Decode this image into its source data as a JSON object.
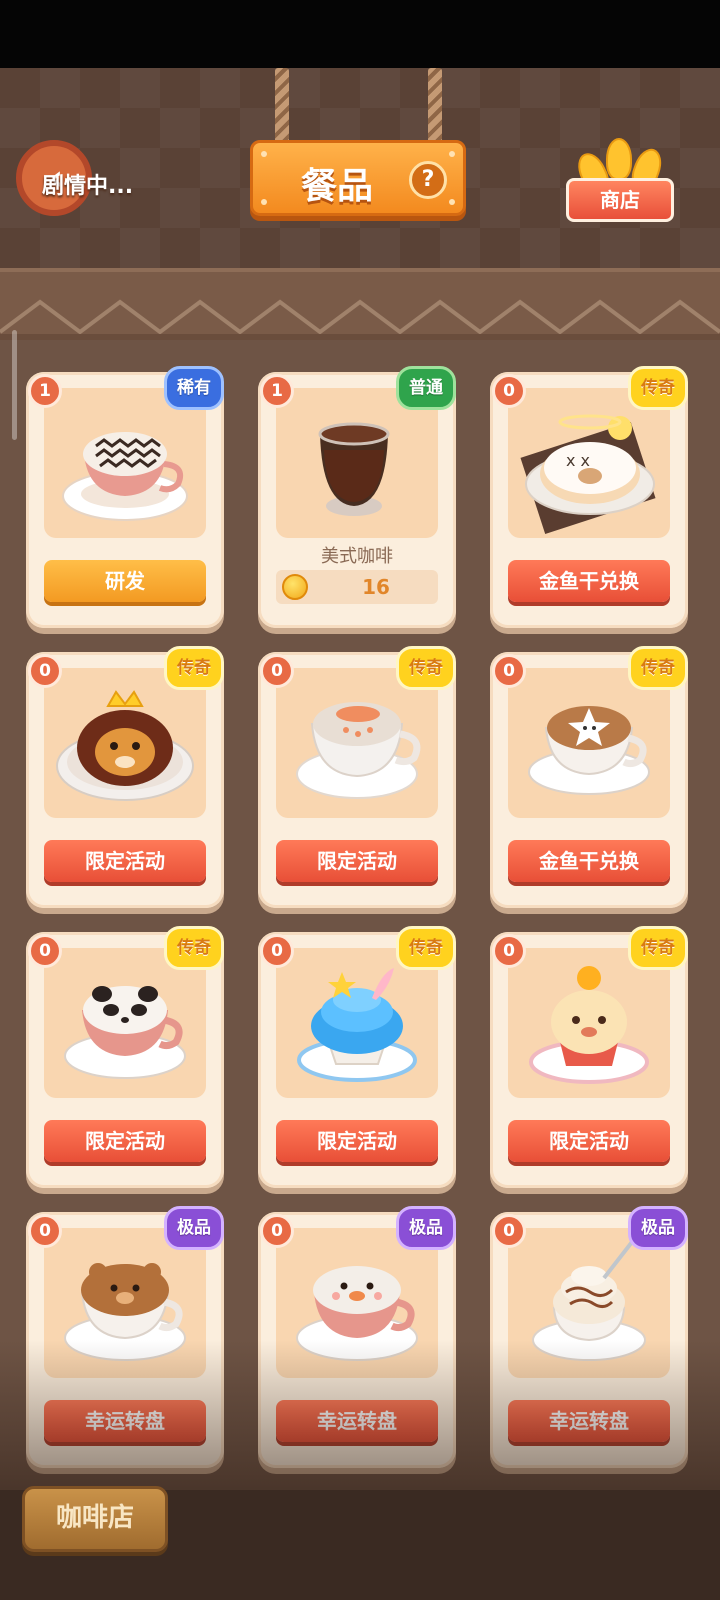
{
  "header": {
    "back_label": "剧情中...",
    "title": "餐品",
    "help_symbol": "?",
    "shop_label": "商店"
  },
  "items": [
    {
      "count": "1",
      "rarity": "稀有",
      "rarity_type": "rare",
      "button": "研发",
      "button_style": "orange",
      "food": "latte-wave"
    },
    {
      "count": "1",
      "rarity": "普通",
      "rarity_type": "common",
      "name": "美式咖啡",
      "price": "16",
      "food": "americano"
    },
    {
      "count": "0",
      "rarity": "传奇",
      "rarity_type": "legend",
      "button": "金鱼干兑换",
      "button_style": "red",
      "food": "donut-cat"
    },
    {
      "count": "0",
      "rarity": "传奇",
      "rarity_type": "legend",
      "button": "限定活动",
      "button_style": "red",
      "food": "lion-cake"
    },
    {
      "count": "0",
      "rarity": "传奇",
      "rarity_type": "legend",
      "button": "限定活动",
      "button_style": "red",
      "food": "bunny-latte"
    },
    {
      "count": "0",
      "rarity": "传奇",
      "rarity_type": "legend",
      "button": "金鱼干兑换",
      "button_style": "red",
      "food": "star-latte"
    },
    {
      "count": "0",
      "rarity": "传奇",
      "rarity_type": "legend",
      "button": "限定活动",
      "button_style": "red",
      "food": "panda-latte"
    },
    {
      "count": "0",
      "rarity": "传奇",
      "rarity_type": "legend",
      "button": "限定活动",
      "button_style": "red",
      "food": "blue-cupcake"
    },
    {
      "count": "0",
      "rarity": "传奇",
      "rarity_type": "legend",
      "button": "限定活动",
      "button_style": "red",
      "food": "chick-cupcake"
    },
    {
      "count": "0",
      "rarity": "极品",
      "rarity_type": "premium",
      "button": "幸运转盘",
      "button_style": "red",
      "food": "bear-latte"
    },
    {
      "count": "0",
      "rarity": "极品",
      "rarity_type": "premium",
      "button": "幸运转盘",
      "button_style": "red",
      "food": "duck-latte"
    },
    {
      "count": "0",
      "rarity": "极品",
      "rarity_type": "premium",
      "button": "幸运转盘",
      "button_style": "red",
      "food": "cream-latte"
    }
  ],
  "bottom": {
    "cafe_tab": "咖啡店"
  }
}
